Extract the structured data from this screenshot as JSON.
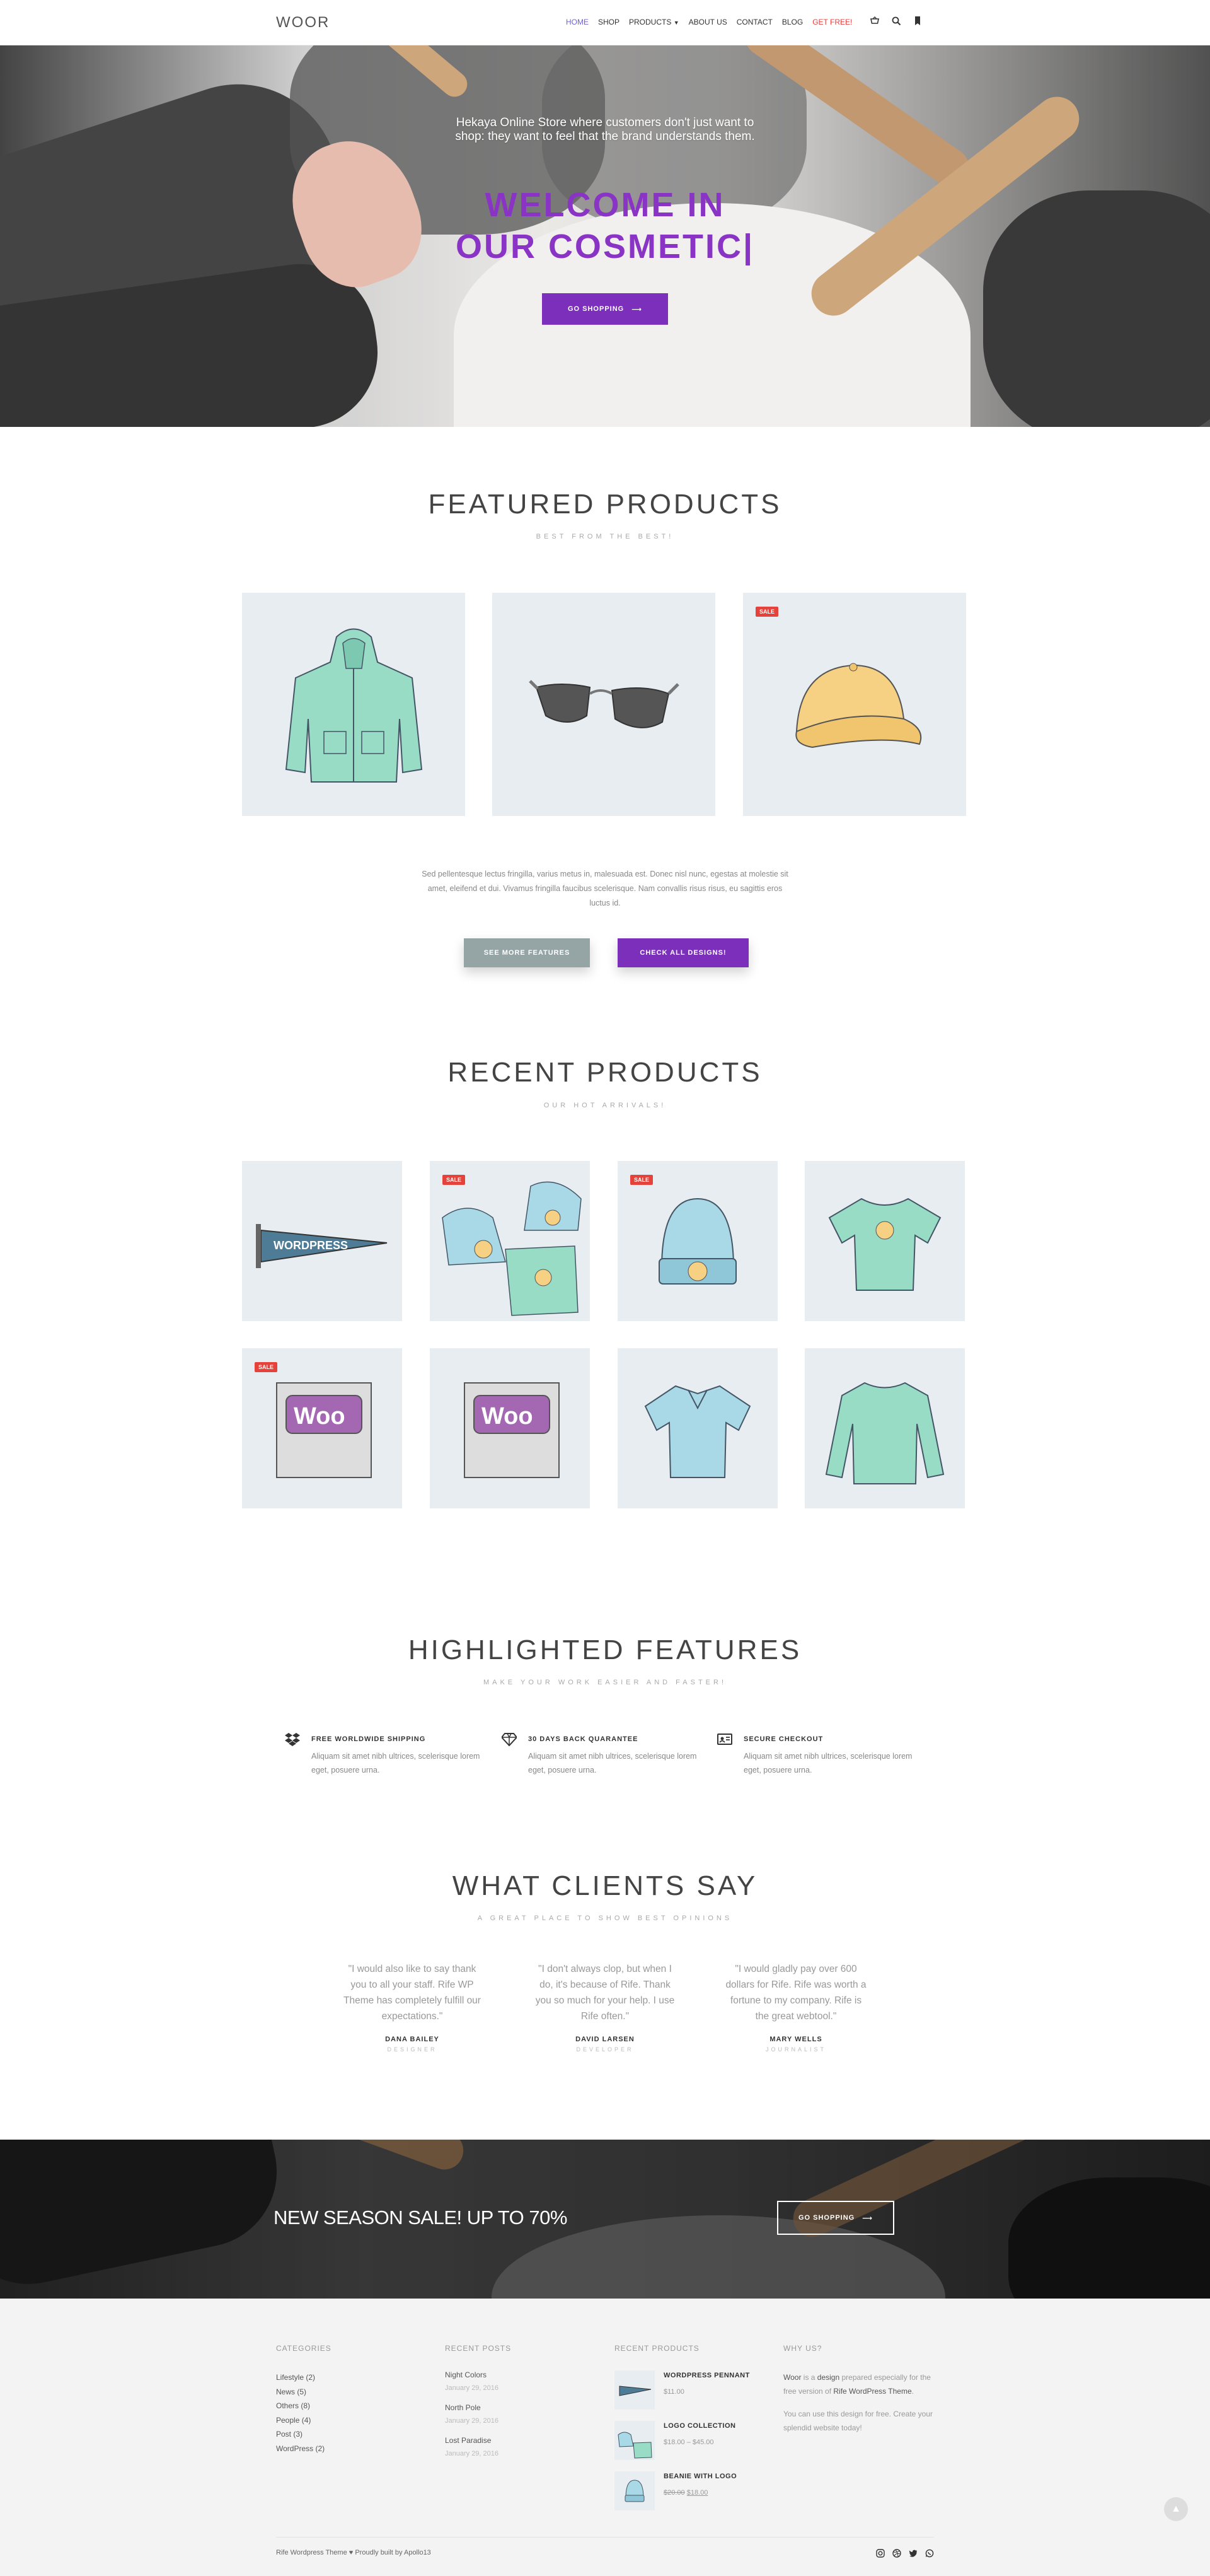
{
  "header": {
    "logo": "WOOR",
    "nav": [
      "HOME",
      "SHOP",
      "PRODUCTS",
      "ABOUT US",
      "CONTACT",
      "BLOG",
      "GET FREE!"
    ],
    "icons": [
      "cart-icon",
      "search-icon",
      "bookmark-icon"
    ]
  },
  "hero": {
    "subtitle": "Hekaya Online Store where customers don't just want to shop: they want to feel that the brand understands them.",
    "title_line1": "WELCOME IN",
    "title_line2": "OUR COSMETIC|",
    "button": "GO SHOPPING"
  },
  "featured": {
    "title": "FEATURED PRODUCTS",
    "subtitle": "BEST FROM THE BEST!",
    "items": [
      {
        "image": "hoodie",
        "sale": false
      },
      {
        "image": "sunglasses",
        "sale": false
      },
      {
        "image": "cap",
        "sale": true
      }
    ],
    "sale_label": "SALE",
    "description": "Sed pellentesque lectus fringilla, varius metus in, malesuada est. Donec nisl nunc, egestas at molestie sit amet, eleifend et dui. Vivamus fringilla faucibus scelerisque. Nam convallis risus risus, eu sagittis eros luctus id.",
    "button_features": "SEE MORE FEATURES",
    "button_designs": "CHECK ALL DESIGNS!",
    "colors": {
      "gray_button": "#95a5a6",
      "purple_button": "#7b2fbb"
    }
  },
  "recent": {
    "title": "RECENT PRODUCTS",
    "subtitle": "OUR HOT ARRIVALS!",
    "sale_label": "SALE",
    "items": [
      {
        "image": "pennant",
        "sale": false
      },
      {
        "image": "logo-collection",
        "sale": true
      },
      {
        "image": "beanie",
        "sale": true
      },
      {
        "image": "tshirt",
        "sale": false
      },
      {
        "image": "woo-album",
        "sale": true
      },
      {
        "image": "woo-album",
        "sale": false
      },
      {
        "image": "polo",
        "sale": false
      },
      {
        "image": "long-sleeve",
        "sale": false
      }
    ]
  },
  "highlighted": {
    "title": "HIGHLIGHTED FEATURES",
    "subtitle": "MAKE YOUR WORK EASIER AND FASTER!",
    "features": [
      {
        "icon": "dropbox-icon",
        "title": "FREE WORLDWIDE SHIPPING",
        "text": "Aliquam sit amet nibh ultrices, scelerisque lorem eget, posuere urna."
      },
      {
        "icon": "diamond-icon",
        "title": "30 DAYS BACK QUARANTEE",
        "text": "Aliquam sit amet nibh ultrices, scelerisque lorem eget, posuere urna."
      },
      {
        "icon": "id-card-icon",
        "title": "SECURE CHECKOUT",
        "text": "Aliquam sit amet nibh ultrices, scelerisque lorem eget, posuere urna."
      }
    ]
  },
  "clients": {
    "title": "WHAT CLIENTS SAY",
    "subtitle": "A GREAT PLACE TO SHOW BEST OPINIONS",
    "testimonials": [
      {
        "quote": "\"I would also like to say thank you to all your staff. Rife WP Theme has completely fulfill our expectations.\"",
        "name": "DANA BAILEY",
        "role": "DESIGNER"
      },
      {
        "quote": "\"I don't always clop, but when I do, it's because of Rife. Thank you so much for your help. I use Rife often.\"",
        "name": "DAVID LARSEN",
        "role": "DEVELOPER"
      },
      {
        "quote": "\"I would gladly pay over 600 dollars for Rife. Rife was worth a fortune to my company. Rife is the great webtool.\"",
        "name": "MARY WELLS",
        "role": "JOURNALIST"
      }
    ]
  },
  "banner": {
    "text": "NEW SEASON SALE! UP TO 70%",
    "button": "GO SHOPPING"
  },
  "footer": {
    "categories_title": "CATEGORIES",
    "categories": [
      "Lifestyle (2)",
      "News (5)",
      "Others (8)",
      "People (4)",
      "Post (3)",
      "WordPress (2)"
    ],
    "posts_title": "RECENT POSTS",
    "posts": [
      {
        "title": "Night Colors",
        "date": "January 29, 2016"
      },
      {
        "title": "North Pole",
        "date": "January 29, 2016"
      },
      {
        "title": "Lost Paradise",
        "date": "January 29, 2016"
      }
    ],
    "products_title": "RECENT PRODUCTS",
    "products": [
      {
        "name": "WORDPRESS PENNANT",
        "price": "$11.00",
        "image": "pennant"
      },
      {
        "name": "LOGO COLLECTION",
        "price": "$18.00 – $45.00",
        "image": "logo-collection"
      },
      {
        "name": "BEANIE WITH LOGO",
        "old_price": "$20.00",
        "price": "$18.00",
        "image": "beanie"
      }
    ],
    "why_title": "WHY US?",
    "why_p1_a": "Woor",
    "why_p1_b": " is a ",
    "why_p1_c": "design",
    "why_p1_d": " prepared especially for the free version of ",
    "why_p1_e": "Rife WordPress Theme",
    "why_p1_f": ".",
    "why_p2": "You can use this design for free. Create your splendid website today!",
    "copyright": "Rife Wordpress Theme ♥ Proudly built by Apollo13",
    "social_icons": [
      "instagram-icon",
      "dribbble-icon",
      "twitter-icon",
      "whatsapp-icon"
    ]
  }
}
